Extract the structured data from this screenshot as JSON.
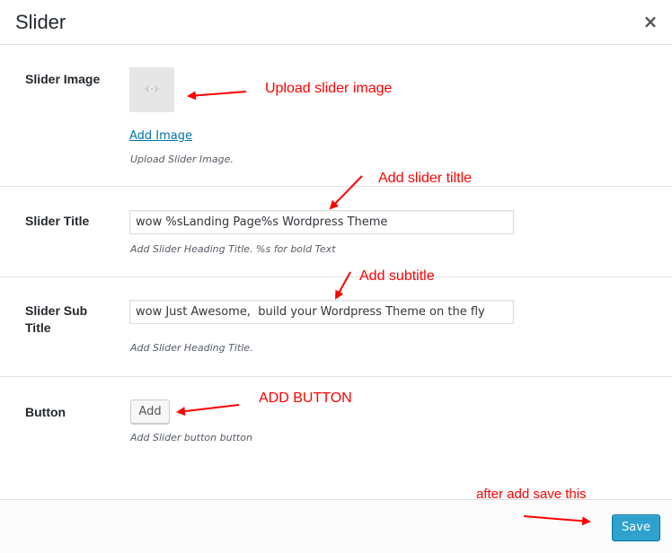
{
  "modal": {
    "title": "Slider",
    "close_glyph": "×"
  },
  "fields": {
    "image": {
      "label": "Slider Image",
      "link": "Add Image",
      "description": "Upload Slider Image."
    },
    "title": {
      "label": "Slider Title",
      "value": "wow %sLanding Page%s Wordpress Theme",
      "description": "Add Slider Heading Title. %s for bold Text"
    },
    "subtitle": {
      "label": "Slider Sub Title",
      "value": "wow Just Awesome,  build your Wordpress Theme on the fly",
      "description": "Add Slider Heading Title."
    },
    "button": {
      "label": "Button",
      "button_label": "Add",
      "description": "Add Slider button button"
    }
  },
  "footer": {
    "save_label": "Save"
  },
  "annotations": {
    "upload_image": "Upload slider image",
    "slider_title": "Add slider tiltle",
    "subtitle": "Add subtitle",
    "add_button": "ADD BUTTON",
    "save": "after add save this"
  },
  "colors": {
    "annotation": "#ff0000",
    "primary_button": "#2ea2cc",
    "link": "#0073aa"
  }
}
